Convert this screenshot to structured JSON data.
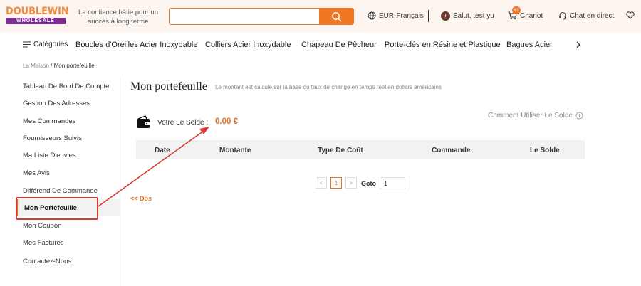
{
  "header": {
    "logo_top": "DOUBLEWIN",
    "logo_bottom": "WHOLESALE",
    "tagline": "La confiance bâtie pour un succès à long terme",
    "search_placeholder": "",
    "currency": "EUR-Français",
    "greeting": "Salut, test yu",
    "avatar_letter": "T",
    "cart_label": "Chariot",
    "cart_count": "63",
    "chat_label": "Chat en direct"
  },
  "nav": {
    "categories": "Catégories",
    "items": [
      "Boucles d'Oreilles Acier Inoxydable",
      "Colliers Acier Inoxydable",
      "Chapeau De Pêcheur",
      "Porte-clés en Résine et Plastique",
      "Bagues Acier I"
    ]
  },
  "breadcrumb": {
    "home": "La Maison",
    "separator": " / ",
    "current": "Mon portefeuille"
  },
  "sidebar": {
    "items": [
      "Tableau De Bord De Compte",
      "Gestion Des Adresses",
      "Mes Commandes",
      "Fournisseurs Suivis",
      "Ma Liste D'envies",
      "Mes Avis",
      "Différend De Commande",
      "Mon Portefeuille",
      "Mon Coupon",
      "Mes Factures",
      "Contactez-Nous"
    ]
  },
  "main": {
    "title": "Mon portefeuille",
    "subtitle": "Le montant est calculé sur la base du taux de change en temps réel en dollars américains",
    "balance_label": "Votre Le Solde :",
    "balance_value": "0.00 €",
    "howto": "Comment Utiliser Le Solde",
    "columns": [
      "Date",
      "Montante",
      "Type De Coût",
      "Commande",
      "Le Solde"
    ],
    "pagination": {
      "prev": "<",
      "current": "1",
      "next": ">",
      "goto_label": "Goto",
      "goto_value": "1"
    },
    "back_link": "<< Dos"
  },
  "colors": {
    "accent": "#f07722",
    "annotation": "#d93a30"
  }
}
